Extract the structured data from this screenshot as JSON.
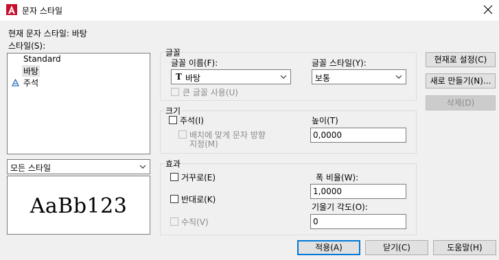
{
  "window": {
    "title": "문자 스타일",
    "close_glyph": "✕"
  },
  "current_style": {
    "label": "현재 문자 스타일: 바탕"
  },
  "styles": {
    "label": "스타일(S):",
    "items": [
      "Standard",
      "바탕",
      "주석"
    ]
  },
  "filter": {
    "value": "모든 스타일"
  },
  "preview": {
    "text": "AaBb123"
  },
  "font_group": {
    "title": "글꼴",
    "font_name_label": "글꼴 이름(F):",
    "font_name_value": "바탕",
    "font_style_label": "글꼴 스타일(Y):",
    "font_style_value": "보통",
    "big_font_label": "큰 글꼴 사용(U)"
  },
  "size_group": {
    "title": "크기",
    "annotative_label": "주석(I)",
    "match_orientation_line1": "배치에 맞게 문자 방향",
    "match_orientation_line2": "지정(M)",
    "height_label": "높이(T)",
    "height_value": "0,0000"
  },
  "effects_group": {
    "title": "효과",
    "upside_down_label": "거꾸로(E)",
    "backwards_label": "반대로(K)",
    "vertical_label": "수직(V)",
    "width_factor_label": "폭 비율(W):",
    "width_factor_value": "1,0000",
    "oblique_label": "기울기 각도(O):",
    "oblique_value": "0"
  },
  "buttons": {
    "set_current": "현재로 설정(C)",
    "new": "새로 만들기(N)...",
    "delete": "삭제(D)",
    "apply": "적용(A)",
    "close": "닫기(C)",
    "help": "도움말(H)"
  },
  "colors": {
    "app_icon_red": "#c8102e",
    "annotative_icon_blue": "#2a6ebb",
    "default_button_border": "#0078d7"
  },
  "icons": {
    "app": "autocad-a-icon",
    "annotative": "annotative-scale-icon",
    "truetype": "truetype-font-icon",
    "dropdown": "chevron-down-icon",
    "close": "close-icon"
  }
}
